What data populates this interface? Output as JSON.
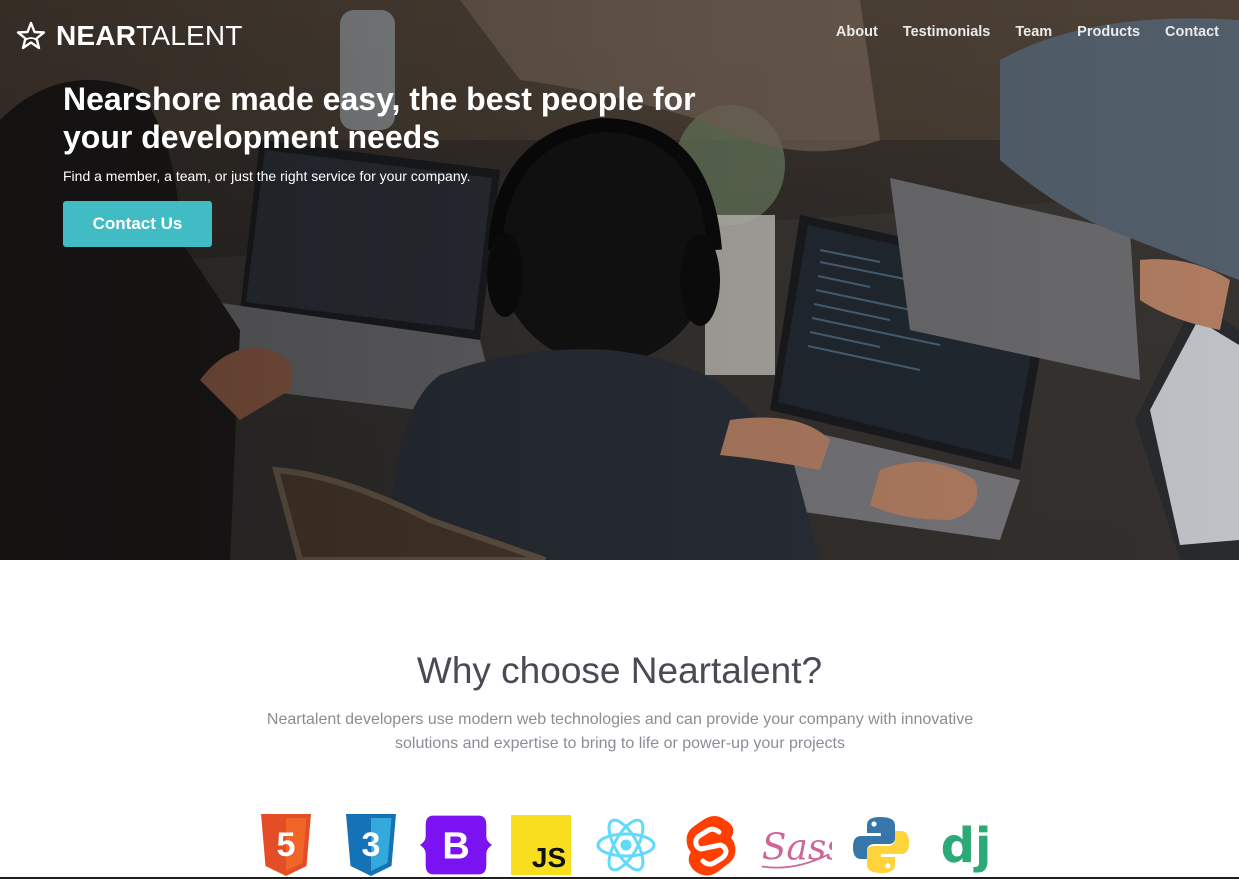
{
  "brand": {
    "name_strong": "NEAR",
    "name_light": "TALENT",
    "logo_icon": "star-outline-icon"
  },
  "nav": {
    "items": [
      "About",
      "Testimonials",
      "Team",
      "Products",
      "Contact"
    ]
  },
  "hero": {
    "title": "Nearshore made easy, the best people for your development needs",
    "subtitle": "Find a member, a team, or just the right service for your company.",
    "cta_label": "Contact Us"
  },
  "why": {
    "title": "Why choose Neartalent?",
    "text": "Neartalent developers use modern web technologies and can provide your company with innovative solutions and expertise to bring to life or power-up your projects"
  },
  "technologies": {
    "html5": {
      "icon": "html5-icon",
      "label": "5"
    },
    "css3": {
      "icon": "css3-icon",
      "label": "3"
    },
    "bootstrap": {
      "icon": "bootstrap-icon",
      "label": "B"
    },
    "javascript": {
      "icon": "javascript-icon",
      "label": "JS"
    },
    "react": {
      "icon": "react-icon"
    },
    "svelte": {
      "icon": "svelte-icon"
    },
    "sass": {
      "icon": "sass-icon",
      "label": "Sass"
    },
    "python": {
      "icon": "python-icon"
    },
    "django": {
      "icon": "django-icon",
      "label": "dj"
    }
  },
  "colors": {
    "accent": "#41bcc4",
    "title": "#4a4a55",
    "body_text": "#8c8c96"
  }
}
